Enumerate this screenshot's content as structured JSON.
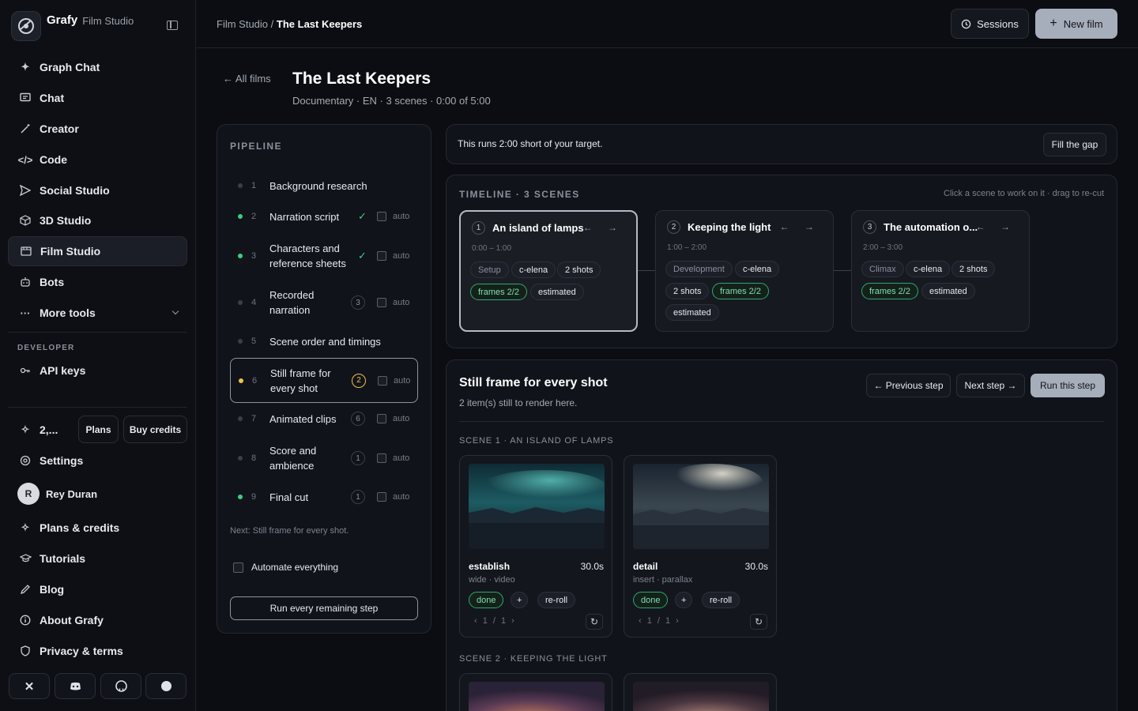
{
  "app": {
    "name": "Grafy",
    "section": "Film Studio"
  },
  "sidebar": {
    "items": [
      {
        "label": "Graph Chat",
        "icon": "sparkle-icon"
      },
      {
        "label": "Chat",
        "icon": "chat-icon"
      },
      {
        "label": "Creator",
        "icon": "wand-icon"
      },
      {
        "label": "Code",
        "icon": "code-icon"
      },
      {
        "label": "Social Studio",
        "icon": "send-icon"
      },
      {
        "label": "3D Studio",
        "icon": "cube-icon"
      },
      {
        "label": "Film Studio",
        "icon": "film-icon",
        "active": true
      },
      {
        "label": "Bots",
        "icon": "bot-icon"
      },
      {
        "label": "More tools",
        "icon": "more-icon"
      }
    ],
    "developer_label": "DEVELOPER",
    "api_keys": "API keys",
    "credits": "2,...",
    "plans_btn": "Plans",
    "buy_credits_btn": "Buy credits",
    "settings": "Settings",
    "user": {
      "initial": "R",
      "name": "Rey Duran"
    },
    "bottom_items": [
      "Plans & credits",
      "Tutorials",
      "Blog",
      "About Grafy",
      "Privacy & terms"
    ]
  },
  "topbar": {
    "crumb_root": "Film Studio",
    "crumb_sep": "/",
    "crumb_current": "The Last Keepers",
    "sessions_btn": "Sessions",
    "new_film_btn": "New film"
  },
  "film": {
    "back": "← All films",
    "title": "The Last Keepers",
    "meta": "Documentary · EN · 3 scenes · 0:00 of 5:00"
  },
  "pipeline": {
    "heading": "PIPELINE",
    "steps": [
      {
        "num": "1",
        "label": "Background research",
        "status": "none"
      },
      {
        "num": "2",
        "label": "Narration script",
        "status": "done",
        "auto": "auto"
      },
      {
        "num": "3",
        "label": "Characters and reference sheets",
        "status": "done",
        "auto": "auto"
      },
      {
        "num": "4",
        "label": "Recorded narration",
        "status": "none",
        "count": "3",
        "auto": "auto"
      },
      {
        "num": "5",
        "label": "Scene order and timings",
        "status": "none"
      },
      {
        "num": "6",
        "label": "Still frame for every shot",
        "status": "current",
        "count": "2",
        "auto": "auto"
      },
      {
        "num": "7",
        "label": "Animated clips",
        "status": "none",
        "count": "6",
        "auto": "auto"
      },
      {
        "num": "8",
        "label": "Score and ambience",
        "status": "none",
        "count": "1",
        "auto": "auto"
      },
      {
        "num": "9",
        "label": "Final cut",
        "status": "done",
        "count": "1",
        "auto": "auto"
      }
    ],
    "next_note": "Next: Still frame for every shot.",
    "automate_label": "Automate everything",
    "run_all": "Run every remaining step"
  },
  "banner": {
    "text": "This runs 2:00 short of your target.",
    "button": "Fill the gap"
  },
  "timeline": {
    "heading": "TIMELINE · 3 SCENES",
    "hint": "Click a scene to work on it · drag to re-cut",
    "scenes": [
      {
        "num": "1",
        "title": "An island of lamps",
        "time": "0:00 – 1:00",
        "arrows": "← →",
        "tags": [
          "Setup",
          "c-elena",
          "2 shots",
          "frames 2/2",
          "estimated"
        ]
      },
      {
        "num": "2",
        "title": "Keeping the light",
        "time": "1:00 – 2:00",
        "arrows": "← →",
        "tags": [
          "Development",
          "c-elena",
          "2 shots",
          "frames 2/2",
          "estimated"
        ]
      },
      {
        "num": "3",
        "title": "The automation o...",
        "time": "2:00 – 3:00",
        "arrows": "← →",
        "tags": [
          "Climax",
          "c-elena",
          "2 shots",
          "frames 2/2",
          "estimated"
        ]
      }
    ]
  },
  "step_panel": {
    "title": "Still frame for every shot",
    "subtitle": "2 item(s) still to render here.",
    "prev_btn": "← Previous step",
    "next_btn": "Next step →",
    "run_btn": "Run this step",
    "scene1_label": "SCENE 1 · AN ISLAND OF LAMPS",
    "scene2_label": "SCENE 2 · KEEPING THE LIGHT",
    "shots": [
      {
        "name": "establish",
        "duration": "30.0s",
        "type": "wide · video",
        "status": "done",
        "add": "+",
        "reroll": "re-roll",
        "pager": "‹  1 / 1  ›"
      },
      {
        "name": "detail",
        "duration": "30.0s",
        "type": "insert · parallax",
        "status": "done",
        "add": "+",
        "reroll": "re-roll",
        "pager": "‹  1 / 1  ›"
      }
    ]
  },
  "colors": {
    "accent_green": "#34d27f",
    "current_yellow": "#f3c33a",
    "primary_button": "#a7aebb"
  }
}
